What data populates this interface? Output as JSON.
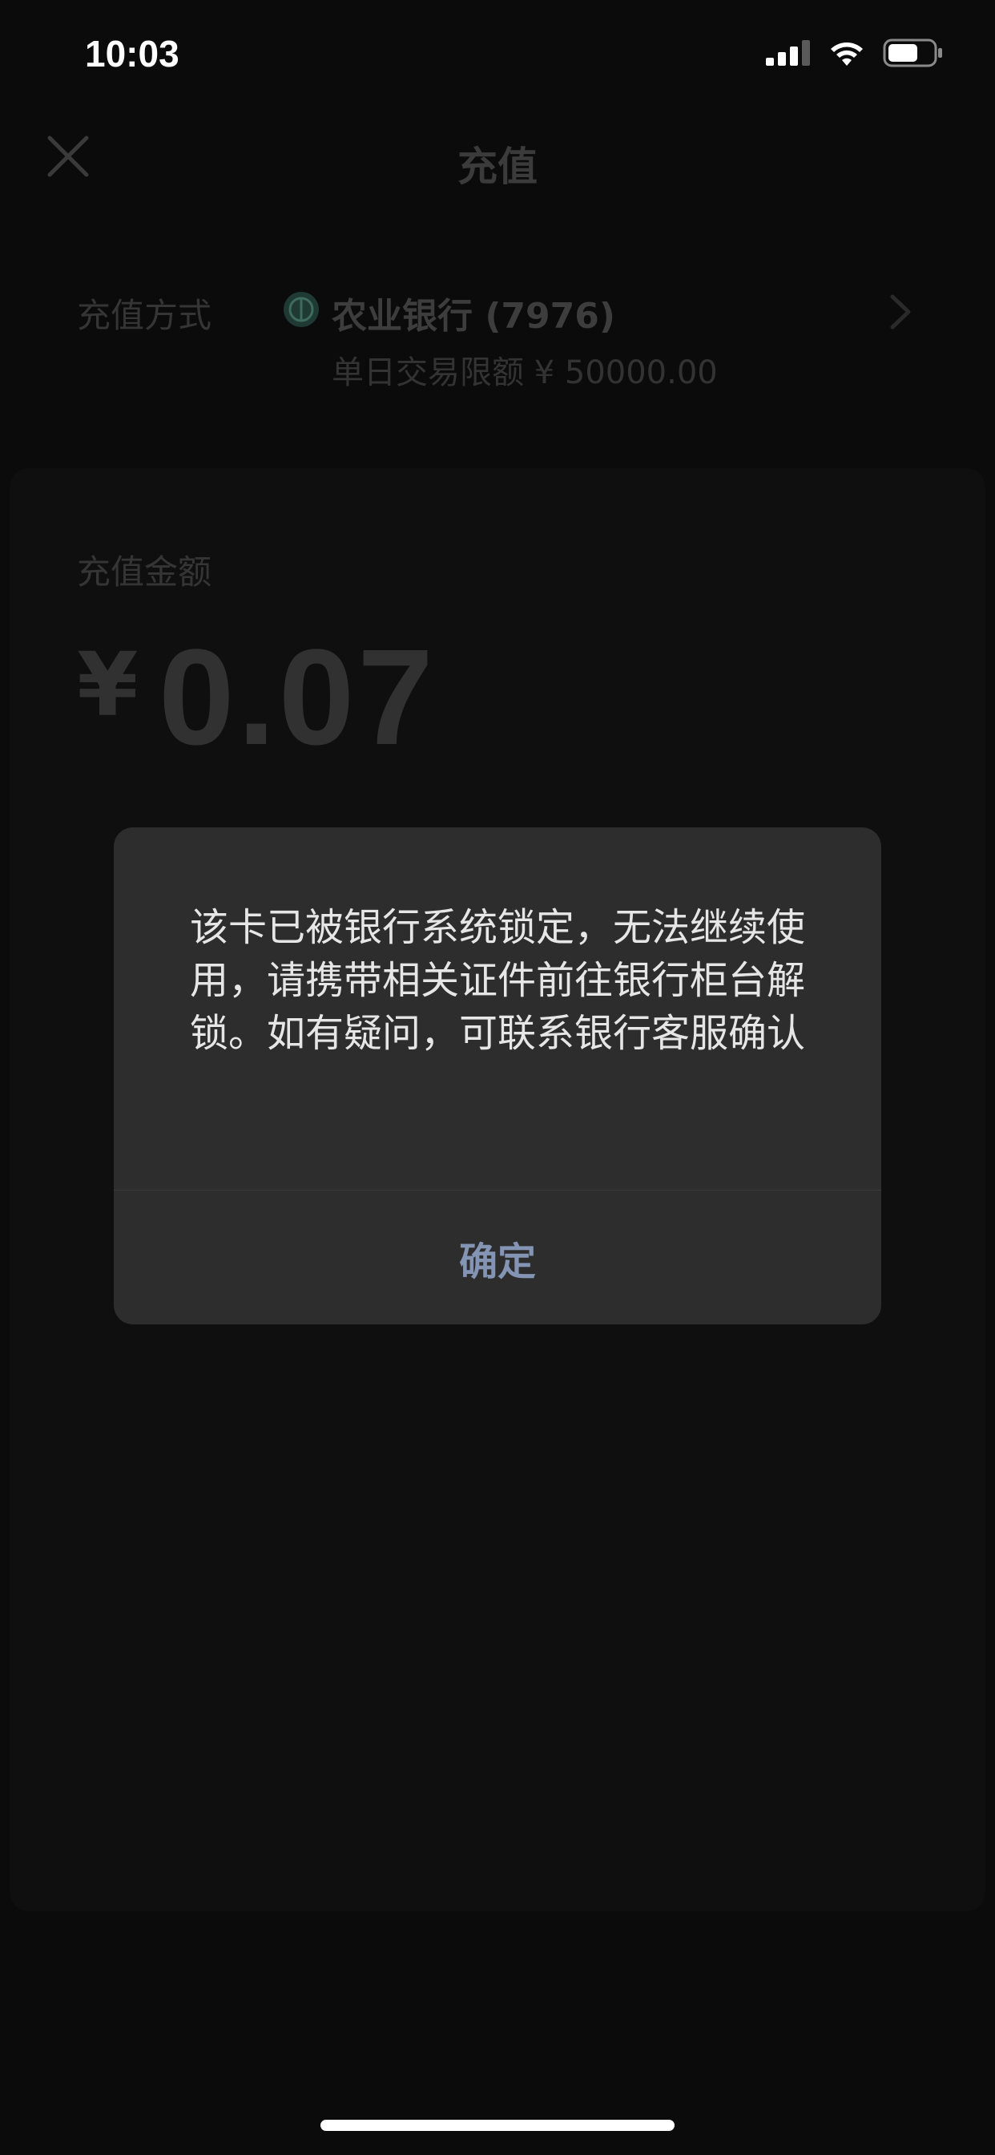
{
  "status_bar": {
    "time": "10:03"
  },
  "header": {
    "title": "充值",
    "close_icon": "close-icon"
  },
  "payment_method": {
    "label": "充值方式",
    "bank": "农业银行 (7976)",
    "limit": "单日交易限额 ¥ 50000.00",
    "bank_icon": "bank-logo-icon",
    "chevron_icon": "chevron-right-icon"
  },
  "amount": {
    "label": "充值金额",
    "currency": "¥",
    "value": "0.07"
  },
  "dialog": {
    "message": "该卡已被银行系统锁定，无法继续使用，请携带相关证件前往银行柜台解锁。如有疑问，可联系银行客服确认",
    "confirm_label": "确定"
  },
  "colors": {
    "background": "#0b0b0b",
    "dialog_bg": "#2d2d2d",
    "confirm_text": "#8494b4"
  }
}
